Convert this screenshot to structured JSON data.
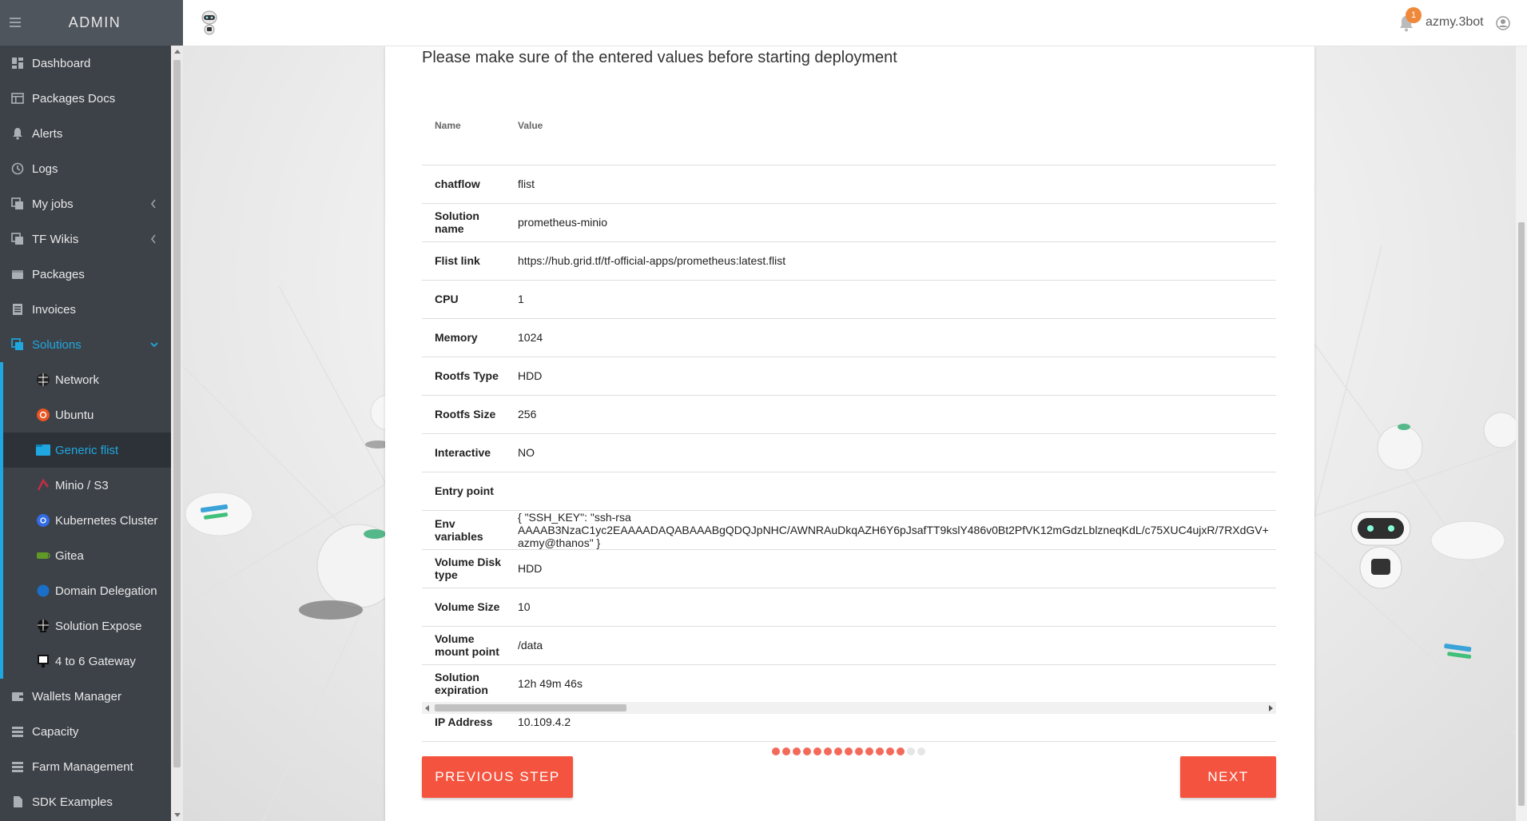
{
  "sidebar": {
    "title": "ADMIN",
    "items": [
      {
        "label": "Dashboard",
        "icon": "dashboard-icon"
      },
      {
        "label": "Packages Docs",
        "icon": "docs-icon"
      },
      {
        "label": "Alerts",
        "icon": "bell-icon"
      },
      {
        "label": "Logs",
        "icon": "history-icon"
      },
      {
        "label": "My jobs",
        "icon": "jobs-icon"
      },
      {
        "label": "TF Wikis",
        "icon": "wiki-icon"
      },
      {
        "label": "Packages",
        "icon": "package-icon"
      },
      {
        "label": "Invoices",
        "icon": "invoice-icon"
      },
      {
        "label": "Solutions",
        "icon": "solutions-icon"
      }
    ],
    "solutions": [
      {
        "label": "Network",
        "icon": "network-icon"
      },
      {
        "label": "Ubuntu",
        "icon": "ubuntu-icon"
      },
      {
        "label": "Generic flist",
        "icon": "folder-icon"
      },
      {
        "label": "Minio / S3",
        "icon": "minio-icon"
      },
      {
        "label": "Kubernetes Cluster",
        "icon": "kubernetes-icon"
      },
      {
        "label": "Gitea",
        "icon": "gitea-icon"
      },
      {
        "label": "Domain Delegation",
        "icon": "domain-icon"
      },
      {
        "label": "Solution Expose",
        "icon": "expose-icon"
      },
      {
        "label": "4 to 6 Gateway",
        "icon": "gateway-icon"
      }
    ],
    "bottom": [
      {
        "label": "Wallets Manager",
        "icon": "wallet-icon"
      },
      {
        "label": "Capacity",
        "icon": "capacity-icon"
      },
      {
        "label": "Farm Management",
        "icon": "farm-icon"
      },
      {
        "label": "SDK Examples",
        "icon": "sdk-icon"
      }
    ]
  },
  "topbar": {
    "notification_count": "1",
    "username": "azmy.3bot"
  },
  "card": {
    "heading": "Please make sure of the entered values before starting deployment",
    "columns": [
      "Name",
      "Value"
    ],
    "rows": [
      {
        "name": "chatflow",
        "value": "flist"
      },
      {
        "name": "Solution name",
        "value": "prometheus-minio"
      },
      {
        "name": "Flist link",
        "value": "https://hub.grid.tf/tf-official-apps/prometheus:latest.flist"
      },
      {
        "name": "CPU",
        "value": "1"
      },
      {
        "name": "Memory",
        "value": "1024"
      },
      {
        "name": "Rootfs Type",
        "value": "HDD"
      },
      {
        "name": "Rootfs Size",
        "value": "256"
      },
      {
        "name": "Interactive",
        "value": "NO"
      },
      {
        "name": "Entry point",
        "value": ""
      },
      {
        "name": "Env variables",
        "value": "{ \"SSH_KEY\": \"ssh-rsa\nAAAAB3NzaC1yc2EAAAADAQABAAABgQDQJpNHC/AWNRAuDkqAZH6Y6pJsafTT9kslY486v0Bt2PfVK12mGdzLblzneqKdL/c75XUC4ujxR/7RXdGV+\nazmy@thanos\" }"
      },
      {
        "name": "Volume Disk type",
        "value": "HDD"
      },
      {
        "name": "Volume Size",
        "value": "10"
      },
      {
        "name": "Volume mount point",
        "value": "/data"
      },
      {
        "name": "Solution expiration",
        "value": "12h 49m 46s"
      },
      {
        "name": "IP Address",
        "value": "10.109.4.2"
      }
    ],
    "steps_total": 15,
    "steps_done": 13,
    "prev_label": "PREVIOUS STEP",
    "next_label": "NEXT"
  },
  "colors": {
    "accent": "#f4543f",
    "sidebar_bg": "#3d4249",
    "sidebar_active": "#1fa8e0"
  }
}
